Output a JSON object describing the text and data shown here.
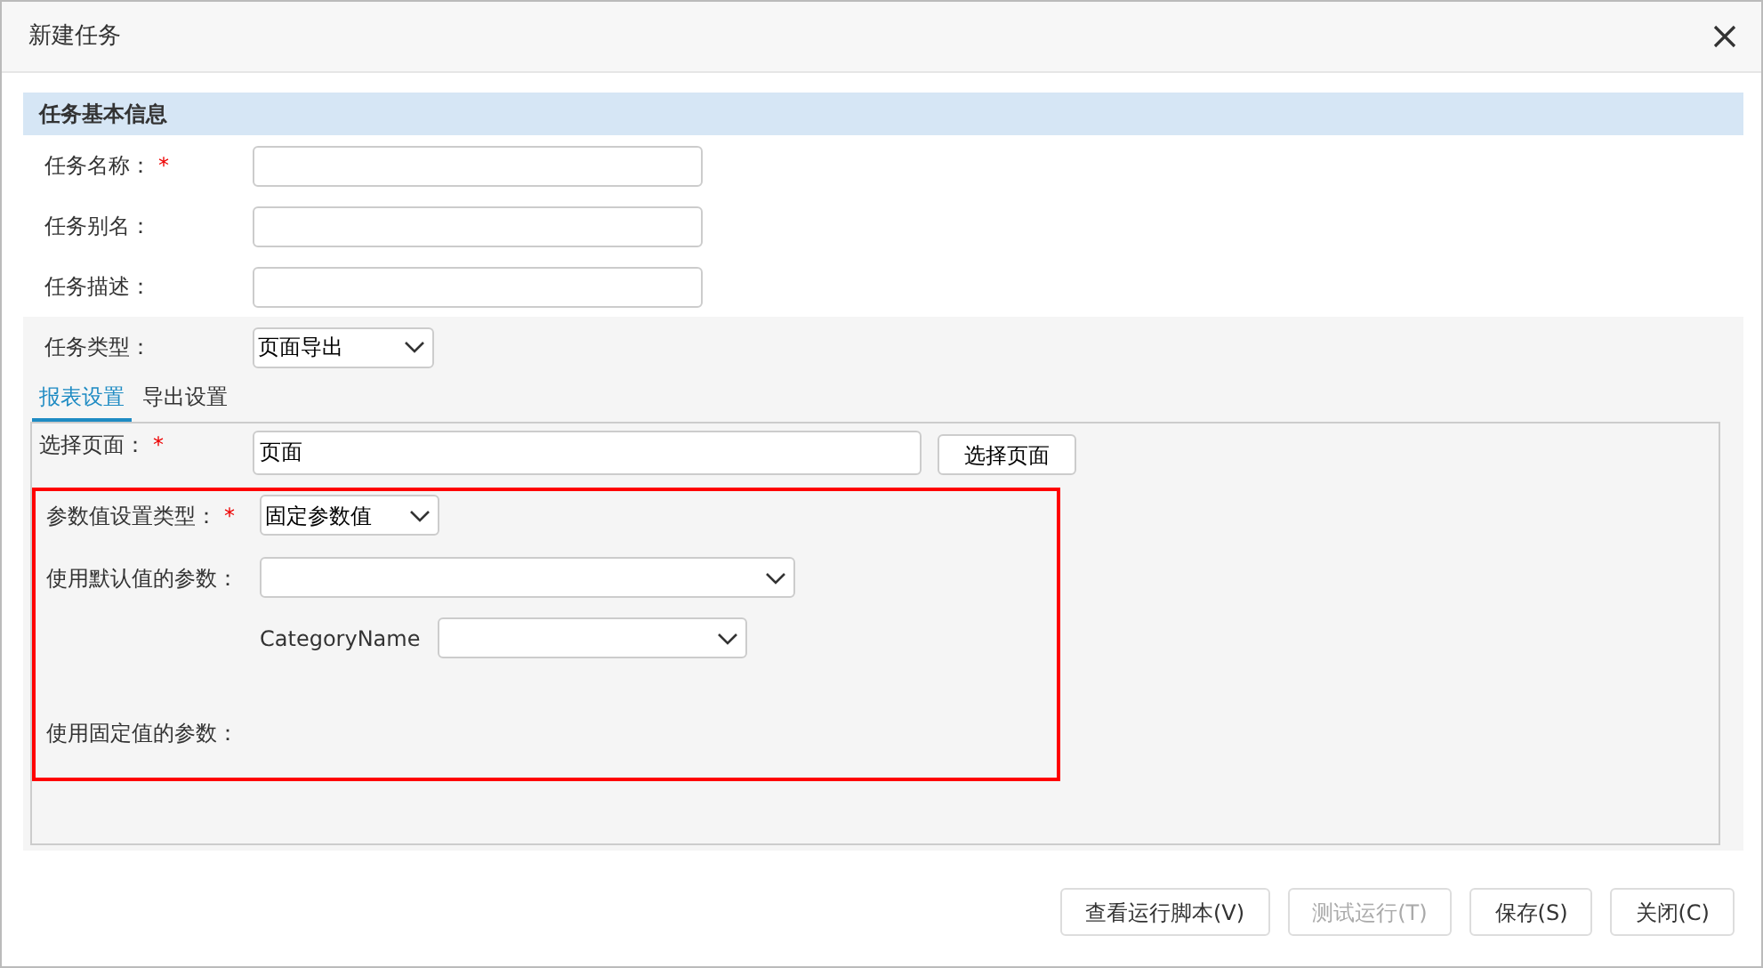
{
  "window": {
    "title": "新建任务"
  },
  "section": {
    "title": "任务基本信息"
  },
  "fields": [
    {
      "label": "任务名称：",
      "required_mark": "*"
    },
    {
      "label": "任务别名："
    },
    {
      "label": "任务描述："
    }
  ],
  "task_type": {
    "label": "任务类型：",
    "value": "页面导出"
  },
  "tabs": [
    {
      "label": "报表设置",
      "selected": true
    },
    {
      "label": "导出设置",
      "selected": false
    }
  ],
  "page_select": {
    "label": "选择页面：",
    "required_mark": "*",
    "value": "页面",
    "button": "选择页面"
  },
  "parameters": {
    "highlighted": true,
    "type_label": "参数值设置类型：",
    "type_required_mark": "*",
    "type_value": "固定参数值",
    "default_label": "使用默认值的参数：",
    "params": [
      {
        "name": "CategoryName"
      }
    ],
    "fixed_label": "使用固定值的参数："
  },
  "buttons": [
    {
      "label": "查看运行脚本(V)",
      "disabled": false
    },
    {
      "label": "测试运行(T)",
      "disabled": true
    },
    {
      "label": "保存(S)",
      "disabled": false
    },
    {
      "label": "关闭(C)",
      "disabled": false
    }
  ]
}
